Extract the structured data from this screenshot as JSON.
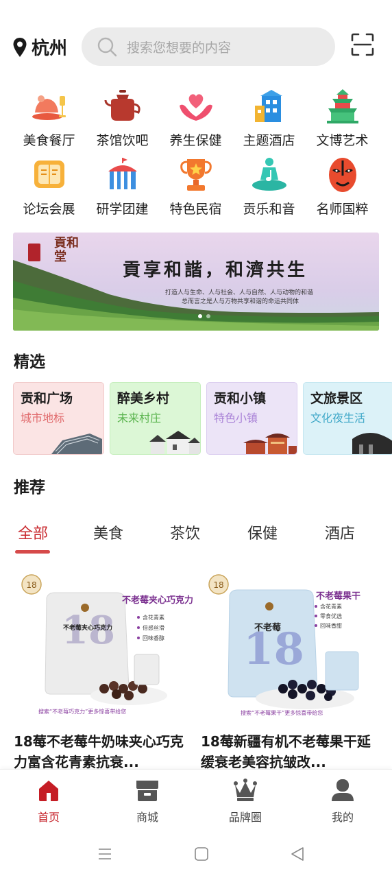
{
  "header": {
    "city": "杭州",
    "search_placeholder": "搜索您想要的内容",
    "location_icon": "location-pin-icon",
    "scan_icon": "scan-icon"
  },
  "categories": [
    {
      "label": "美食餐厅",
      "icon": "food-icon"
    },
    {
      "label": "茶馆饮吧",
      "icon": "teapot-icon"
    },
    {
      "label": "养生保健",
      "icon": "heart-hands-icon"
    },
    {
      "label": "主题酒店",
      "icon": "hotel-icon"
    },
    {
      "label": "文博艺术",
      "icon": "temple-icon"
    },
    {
      "label": "论坛会展",
      "icon": "book-icon"
    },
    {
      "label": "研学团建",
      "icon": "tent-icon"
    },
    {
      "label": "特色民宿",
      "icon": "trophy-icon"
    },
    {
      "label": "贡乐和音",
      "icon": "music-icon"
    },
    {
      "label": "名师国粹",
      "icon": "opera-mask-icon"
    }
  ],
  "banner": {
    "logo_text": "貢和堂",
    "title": "貢享和諧，和濟共生",
    "subtitle_line1": "打造人与生命、人与社会、人与自然、人与动物的和谐",
    "subtitle_line2": "总而言之是人与万物共享和谐的命运共同体",
    "dot_count": 2,
    "active_dot": 0
  },
  "featured": {
    "title": "精选",
    "cards": [
      {
        "title": "贡和广场",
        "subtitle": "城市地标",
        "bg": "#fbe4e4",
        "accent": "#e0696b"
      },
      {
        "title": "醉美乡村",
        "subtitle": "未来村庄",
        "bg": "#dcf7d6",
        "accent": "#5ab44e"
      },
      {
        "title": "贡和小镇",
        "subtitle": "特色小镇",
        "bg": "#ece4f7",
        "accent": "#a77fd6"
      },
      {
        "title": "文旅景区",
        "subtitle": "文化夜生活",
        "bg": "#dcf2f8",
        "accent": "#3fa8c8"
      }
    ]
  },
  "recommend": {
    "title": "推荐",
    "tabs": [
      "全部",
      "美食",
      "茶饮",
      "保健",
      "酒店"
    ],
    "active_tab": 0
  },
  "products": [
    {
      "title": "18莓不老莓牛奶味夹心巧克力富含花青素抗衰...",
      "pkg_name": "不老莓夹心巧克力",
      "pkg_brand": "不老莓夹心巧克力",
      "bullets": [
        "含花青素",
        "倍感丝滑",
        "回味香醇"
      ],
      "footer": "搜索“不老莓巧克力”更多惊喜带给您"
    },
    {
      "title": "18莓新疆有机不老莓果干延缓衰老美容抗皱改...",
      "pkg_name": "不老莓果干",
      "pkg_brand": "不老莓",
      "bullets": [
        "含花青素",
        "零食优选",
        "回味香甜"
      ],
      "footer": "搜索“不老莓果干”更多惊喜带给您"
    }
  ],
  "bottom_nav": {
    "items": [
      {
        "label": "首页",
        "icon": "home-icon"
      },
      {
        "label": "商城",
        "icon": "store-icon"
      },
      {
        "label": "品牌圈",
        "icon": "crown-icon"
      },
      {
        "label": "我的",
        "icon": "user-icon"
      }
    ],
    "active": 0
  },
  "colors": {
    "brand_red": "#c51d25",
    "search_bg": "#ebebeb",
    "tab_underline": "#d64a4a"
  }
}
